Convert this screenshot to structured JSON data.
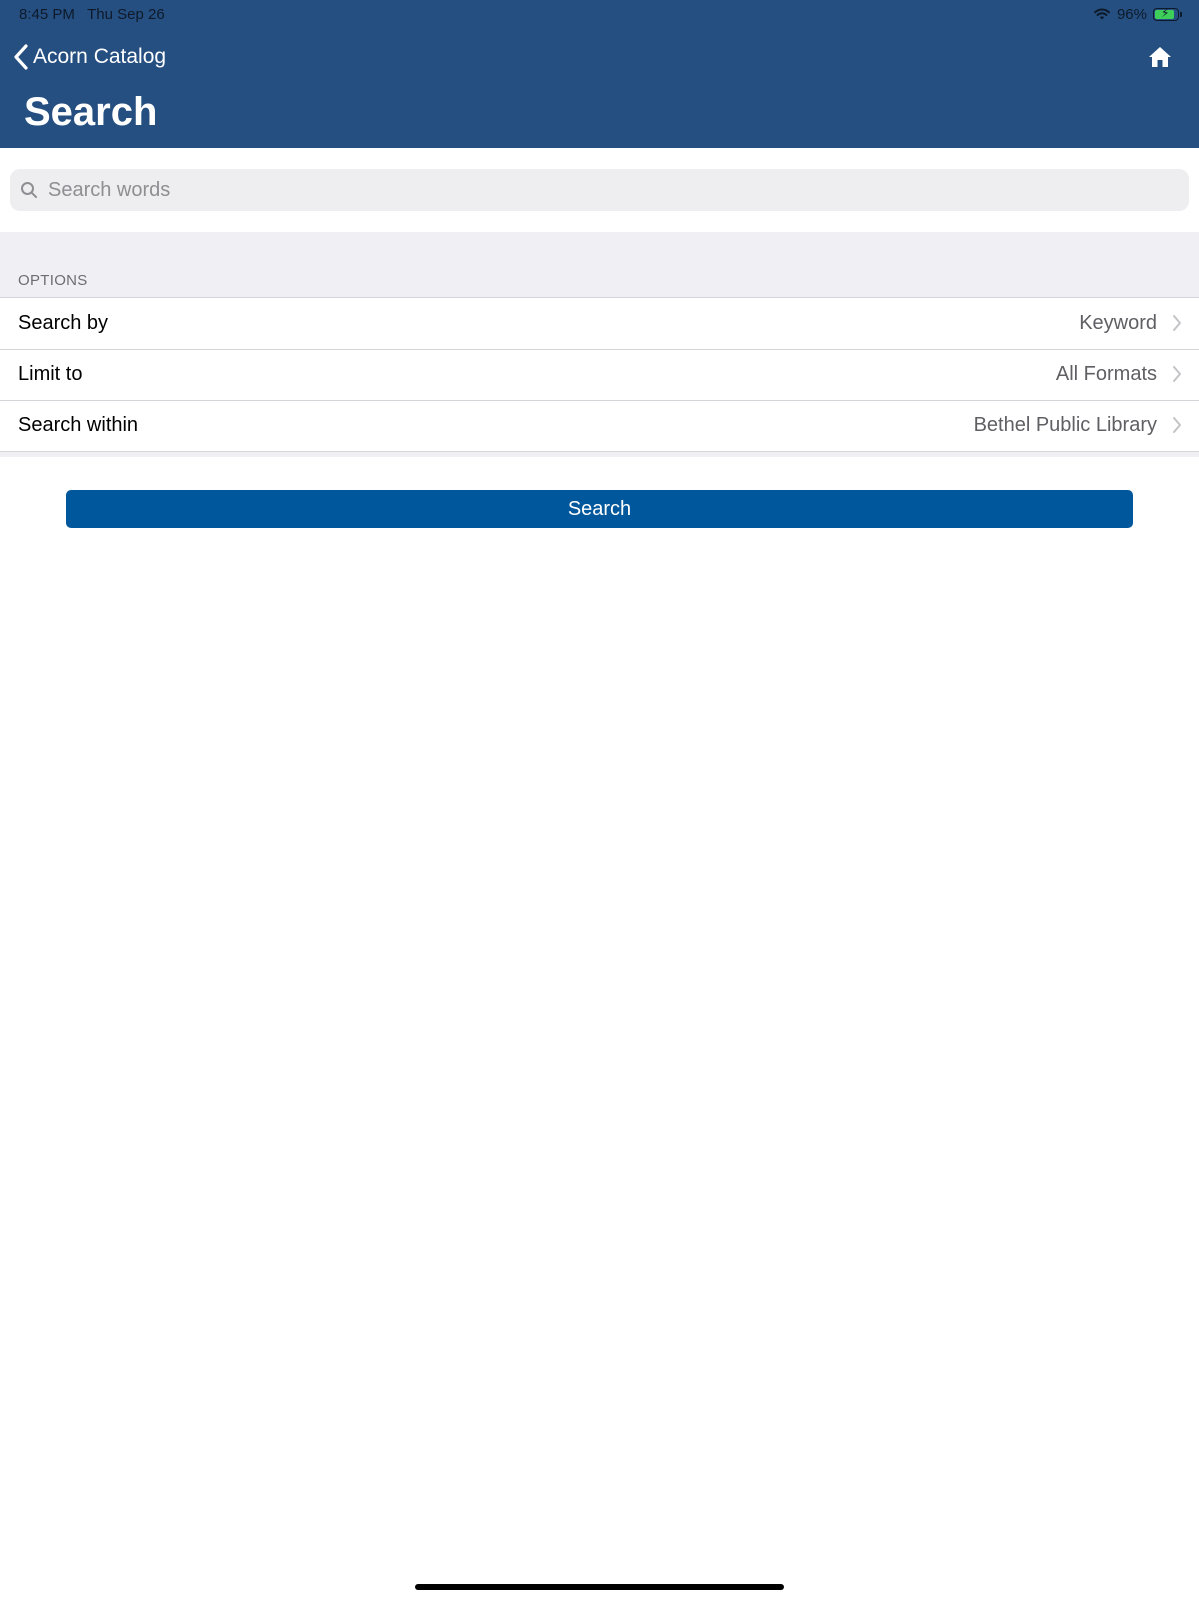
{
  "status_bar": {
    "time": "8:45 PM",
    "date": "Thu Sep 26",
    "battery": "96%",
    "battery_level_percent": 96,
    "wifi_icon": "wifi-icon",
    "charging": true
  },
  "nav": {
    "back_label": "Acorn Catalog",
    "back_icon": "chevron-left-icon",
    "home_icon": "home-icon"
  },
  "page": {
    "title": "Search"
  },
  "search": {
    "placeholder": "Search words",
    "value": "",
    "icon": "search-icon"
  },
  "options": {
    "header": "OPTIONS",
    "rows": [
      {
        "label": "Search by",
        "value": "Keyword"
      },
      {
        "label": "Limit to",
        "value": "All Formats"
      },
      {
        "label": "Search within",
        "value": "Bethel Public Library"
      }
    ]
  },
  "actions": {
    "search_label": "Search"
  },
  "colors": {
    "header_bg": "#254f81",
    "button_bg": "#01579b",
    "battery_fill": "#3ecf5b"
  }
}
